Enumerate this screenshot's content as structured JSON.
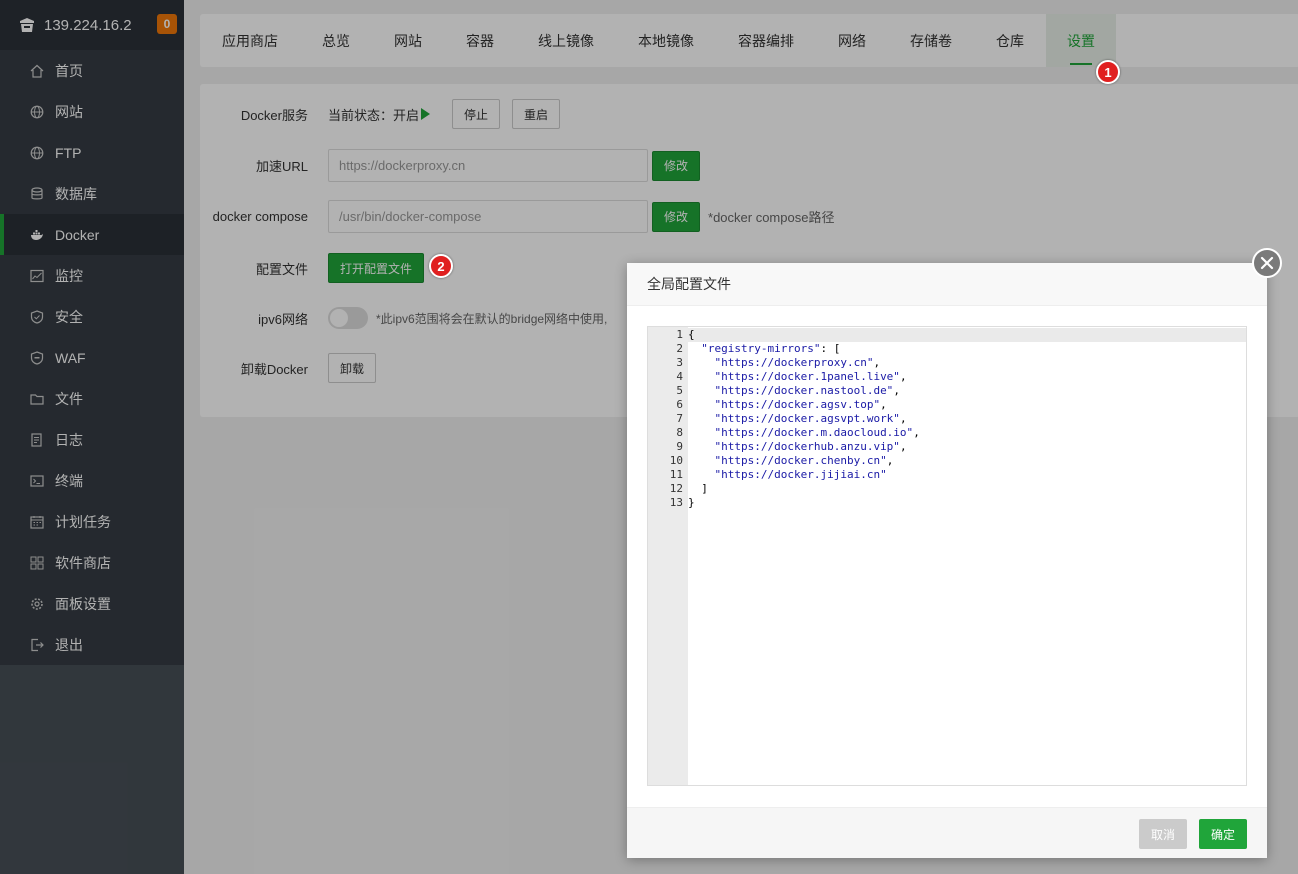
{
  "sidebar": {
    "host": "139.224.16.2",
    "badge": "0",
    "items": [
      {
        "label": "首页",
        "icon": "home-icon"
      },
      {
        "label": "网站",
        "icon": "globe-icon"
      },
      {
        "label": "FTP",
        "icon": "ftp-globe-icon"
      },
      {
        "label": "数据库",
        "icon": "database-icon"
      },
      {
        "label": "Docker",
        "icon": "docker-icon"
      },
      {
        "label": "监控",
        "icon": "monitor-icon"
      },
      {
        "label": "安全",
        "icon": "shield-icon"
      },
      {
        "label": "WAF",
        "icon": "waf-icon"
      },
      {
        "label": "文件",
        "icon": "folder-icon"
      },
      {
        "label": "日志",
        "icon": "log-icon"
      },
      {
        "label": "终端",
        "icon": "terminal-icon"
      },
      {
        "label": "计划任务",
        "icon": "calendar-icon"
      },
      {
        "label": "软件商店",
        "icon": "grid-icon"
      },
      {
        "label": "面板设置",
        "icon": "gear-icon"
      },
      {
        "label": "退出",
        "icon": "logout-icon"
      }
    ]
  },
  "tabs": [
    "应用商店",
    "总览",
    "网站",
    "容器",
    "线上镜像",
    "本地镜像",
    "容器编排",
    "网络",
    "存储卷",
    "仓库",
    "设置"
  ],
  "settings": {
    "service_label": "Docker服务",
    "status_text": "当前状态：开启",
    "stop_label": "停止",
    "restart_label": "重启",
    "mirror_label": "加速URL",
    "mirror_value": "https://dockerproxy.cn",
    "modify_label": "修改",
    "compose_label": "docker compose",
    "compose_value": "/usr/bin/docker-compose",
    "compose_hint": "*docker compose路径",
    "config_label": "配置文件",
    "open_config_label": "打开配置文件",
    "ipv6_label": "ipv6网络",
    "ipv6_hint": "*此ipv6范围将会在默认的bridge网络中使用,",
    "uninstall_label": "卸载Docker",
    "uninstall_btn": "卸载"
  },
  "markers": {
    "one": "1",
    "two": "2"
  },
  "modal": {
    "title": "全局配置文件",
    "lines": [
      "{",
      "  \"registry-mirrors\": [",
      "    \"https://dockerproxy.cn\",",
      "    \"https://docker.1panel.live\",",
      "    \"https://docker.nastool.de\",",
      "    \"https://docker.agsv.top\",",
      "    \"https://docker.agsvpt.work\",",
      "    \"https://docker.m.daocloud.io\",",
      "    \"https://dockerhub.anzu.vip\",",
      "    \"https://docker.chenby.cn\",",
      "    \"https://docker.jijiai.cn\"",
      "  ]",
      "}"
    ],
    "cancel_label": "取消",
    "ok_label": "确定"
  }
}
